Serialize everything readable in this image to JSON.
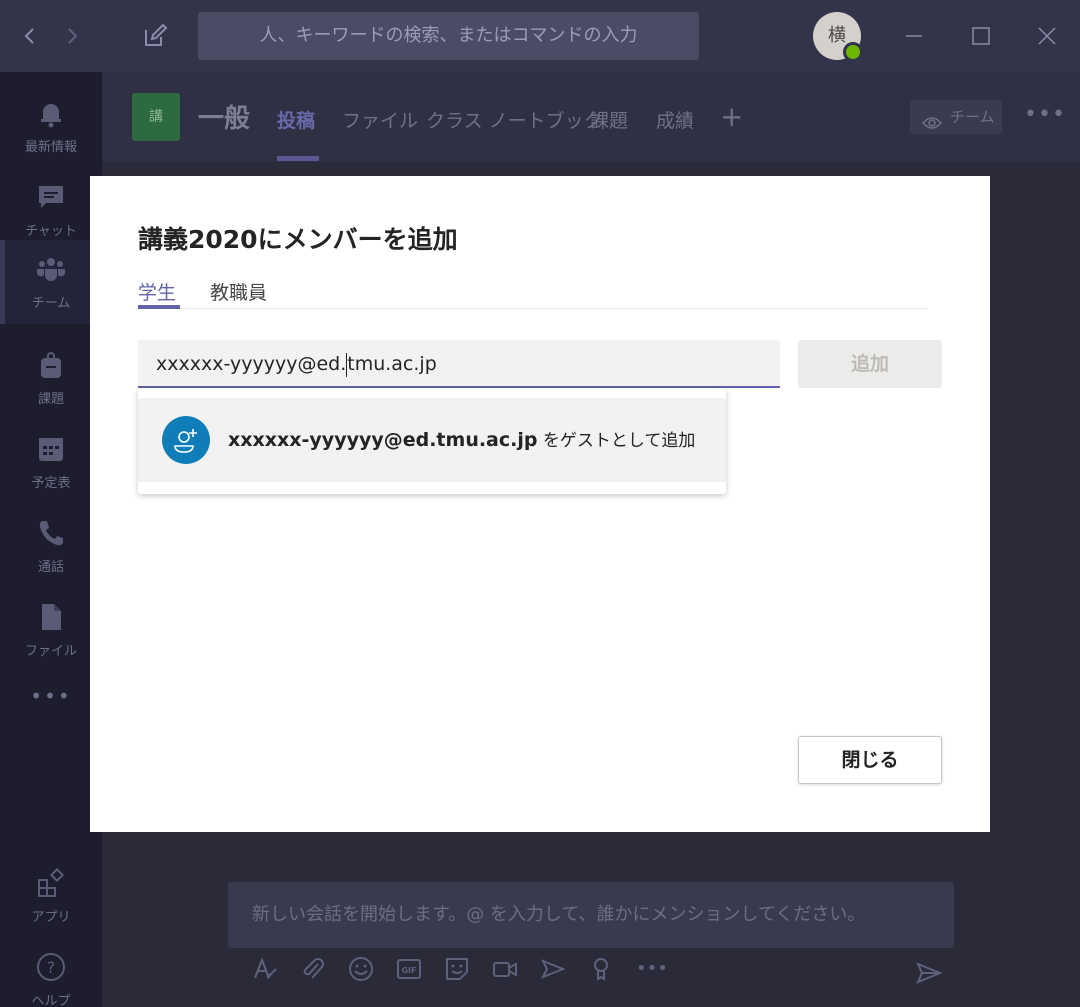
{
  "titlebar": {
    "search_placeholder": "人、キーワードの検索、またはコマンドの入力",
    "avatar_initial": "横"
  },
  "rail": {
    "items": [
      {
        "label": "最新情報",
        "icon": "bell-icon"
      },
      {
        "label": "チャット",
        "icon": "chat-icon"
      },
      {
        "label": "チーム",
        "icon": "teams-icon"
      },
      {
        "label": "課題",
        "icon": "backpack-icon"
      },
      {
        "label": "予定表",
        "icon": "calendar-icon"
      },
      {
        "label": "通話",
        "icon": "phone-icon"
      },
      {
        "label": "ファイル",
        "icon": "file-icon"
      }
    ],
    "more": "•••",
    "apps_label": "アプリ",
    "help_label": "ヘルプ"
  },
  "channel": {
    "team_tile": "講",
    "name": "一般",
    "tabs": [
      "投稿",
      "ファイル",
      "クラス ノートブック",
      "課題",
      "成績"
    ],
    "team_button": "チーム",
    "compose_placeholder": "新しい会話を開始します。@ を入力して、誰かにメンションしてください。"
  },
  "modal": {
    "title": "講義2020にメンバーを追加",
    "tabs": [
      "学生",
      "教職員"
    ],
    "input_value_before_caret": "xxxxxx-yyyyyy@ed.",
    "input_value_after_caret": "tmu.ac.jp",
    "add_button": "追加",
    "suggestion_email": "xxxxxx-yyyyyy@ed.tmu.ac.jp",
    "suggestion_suffix": " をゲストとして追加",
    "close_button": "閉じる"
  },
  "colors": {
    "accent": "#6264a7",
    "guest_avatar": "#0f7eb8",
    "presence": "#6bb700"
  }
}
